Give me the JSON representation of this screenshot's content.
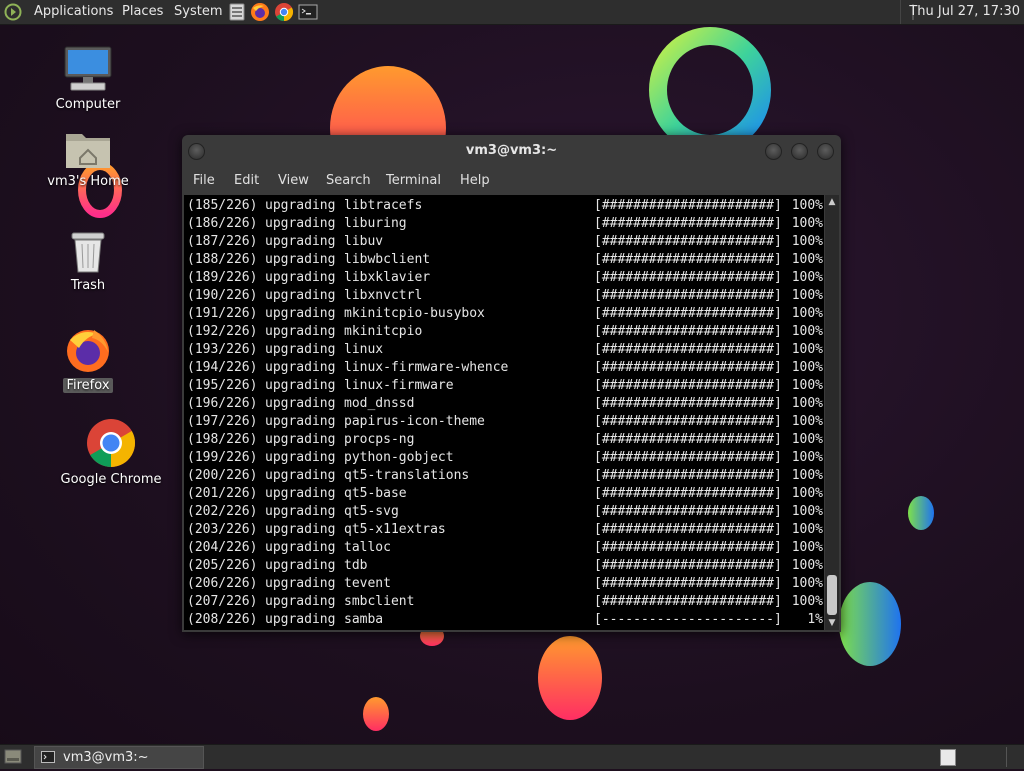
{
  "top_panel": {
    "applications": "Applications",
    "places": "Places",
    "system": "System",
    "clock": "Thu Jul 27, 17:30"
  },
  "desktop_icons": {
    "computer": "Computer",
    "home": "vm3's Home",
    "trash": "Trash",
    "firefox": "Firefox",
    "chrome": "Google Chrome"
  },
  "terminal": {
    "title": "vm3@vm3:~",
    "menu": [
      "File",
      "Edit",
      "View",
      "Search",
      "Terminal",
      "Help"
    ],
    "lines": [
      {
        "n": "(185/226)",
        "pkg": "libtracefs",
        "bar": "[######################]",
        "pct": "100%"
      },
      {
        "n": "(186/226)",
        "pkg": "liburing",
        "bar": "[######################]",
        "pct": "100%"
      },
      {
        "n": "(187/226)",
        "pkg": "libuv",
        "bar": "[######################]",
        "pct": "100%"
      },
      {
        "n": "(188/226)",
        "pkg": "libwbclient",
        "bar": "[######################]",
        "pct": "100%"
      },
      {
        "n": "(189/226)",
        "pkg": "libxklavier",
        "bar": "[######################]",
        "pct": "100%"
      },
      {
        "n": "(190/226)",
        "pkg": "libxnvctrl",
        "bar": "[######################]",
        "pct": "100%"
      },
      {
        "n": "(191/226)",
        "pkg": "mkinitcpio-busybox",
        "bar": "[######################]",
        "pct": "100%"
      },
      {
        "n": "(192/226)",
        "pkg": "mkinitcpio",
        "bar": "[######################]",
        "pct": "100%"
      },
      {
        "n": "(193/226)",
        "pkg": "linux",
        "bar": "[######################]",
        "pct": "100%"
      },
      {
        "n": "(194/226)",
        "pkg": "linux-firmware-whence",
        "bar": "[######################]",
        "pct": "100%"
      },
      {
        "n": "(195/226)",
        "pkg": "linux-firmware",
        "bar": "[######################]",
        "pct": "100%"
      },
      {
        "n": "(196/226)",
        "pkg": "mod_dnssd",
        "bar": "[######################]",
        "pct": "100%"
      },
      {
        "n": "(197/226)",
        "pkg": "papirus-icon-theme",
        "bar": "[######################]",
        "pct": "100%"
      },
      {
        "n": "(198/226)",
        "pkg": "procps-ng",
        "bar": "[######################]",
        "pct": "100%"
      },
      {
        "n": "(199/226)",
        "pkg": "python-gobject",
        "bar": "[######################]",
        "pct": "100%"
      },
      {
        "n": "(200/226)",
        "pkg": "qt5-translations",
        "bar": "[######################]",
        "pct": "100%"
      },
      {
        "n": "(201/226)",
        "pkg": "qt5-base",
        "bar": "[######################]",
        "pct": "100%"
      },
      {
        "n": "(202/226)",
        "pkg": "qt5-svg",
        "bar": "[######################]",
        "pct": "100%"
      },
      {
        "n": "(203/226)",
        "pkg": "qt5-x11extras",
        "bar": "[######################]",
        "pct": "100%"
      },
      {
        "n": "(204/226)",
        "pkg": "talloc",
        "bar": "[######################]",
        "pct": "100%"
      },
      {
        "n": "(205/226)",
        "pkg": "tdb",
        "bar": "[######################]",
        "pct": "100%"
      },
      {
        "n": "(206/226)",
        "pkg": "tevent",
        "bar": "[######################]",
        "pct": "100%"
      },
      {
        "n": "(207/226)",
        "pkg": "smbclient",
        "bar": "[######################]",
        "pct": "100%"
      },
      {
        "n": "(208/226)",
        "pkg": "samba",
        "bar": "[----------------------]",
        "pct": "1%"
      }
    ]
  },
  "taskbar": {
    "window_label": "vm3@vm3:~"
  },
  "colors": {
    "desktop_bg": "#1e0f1e",
    "panel_bg": "#2e2e2e",
    "terminal_bg": "#000000",
    "terminal_fg": "#e6e6e6"
  }
}
